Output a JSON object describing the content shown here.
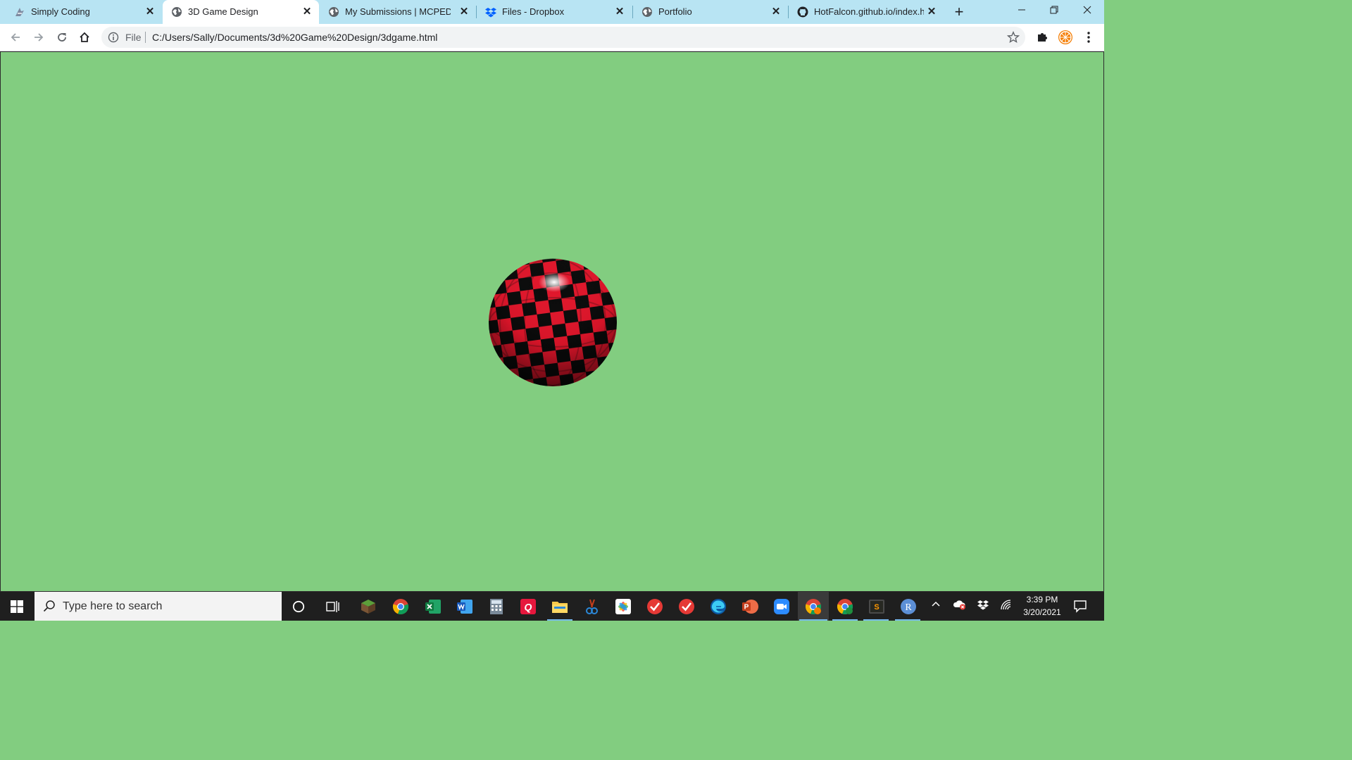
{
  "browser": {
    "tabs": [
      {
        "title": "Simply Coding",
        "icon": "simply-coding-favicon",
        "active": false
      },
      {
        "title": "3D Game Design",
        "icon": "globe-icon",
        "active": true
      },
      {
        "title": "My Submissions | MCPEDL",
        "icon": "globe-icon",
        "active": false
      },
      {
        "title": "Files - Dropbox",
        "icon": "dropbox-icon",
        "active": false
      },
      {
        "title": "Portfolio",
        "icon": "globe-icon",
        "active": false
      },
      {
        "title": "HotFalcon.github.io/index.htm",
        "icon": "github-icon",
        "active": false
      }
    ],
    "new_tab": "+",
    "address": {
      "scheme_chip": "File",
      "url": "C:/Users/Sally/Documents/3d%20Game%20Design/3dgame.html"
    }
  },
  "page": {
    "background": "#82cd80",
    "ball": {
      "colors": [
        "#e0152a",
        "#000000"
      ],
      "pattern": "checkerboard sphere"
    }
  },
  "taskbar": {
    "search_placeholder": "Type here to search",
    "time": "3:39 PM",
    "date": "3/20/2021",
    "accent": "#76b9ed"
  }
}
